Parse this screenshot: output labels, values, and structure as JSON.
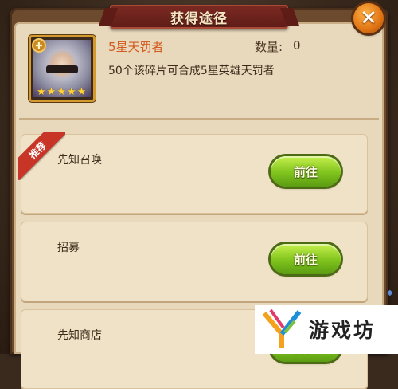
{
  "dialog": {
    "title": "获得途径",
    "close_icon": "close-icon"
  },
  "hero": {
    "name": "5星天罚者",
    "count_label": "数量:",
    "count_value": "0",
    "description": "50个该碎片可合成5星英雄天罚者",
    "stars": 5,
    "emblem_icon": "cross-emblem-icon"
  },
  "sources": [
    {
      "label": "先知召唤",
      "button": "前往",
      "recommended": true,
      "badge": "推荐"
    },
    {
      "label": "招募",
      "button": "前往",
      "recommended": false
    },
    {
      "label": "先知商店",
      "button": "前往",
      "recommended": false
    }
  ],
  "watermark": {
    "text": "游戏坊"
  },
  "colors": {
    "hero_name": "#d25a1e",
    "go_button": "#7fc31d",
    "close_button": "#e07312",
    "title_banner": "#7b2a22"
  }
}
